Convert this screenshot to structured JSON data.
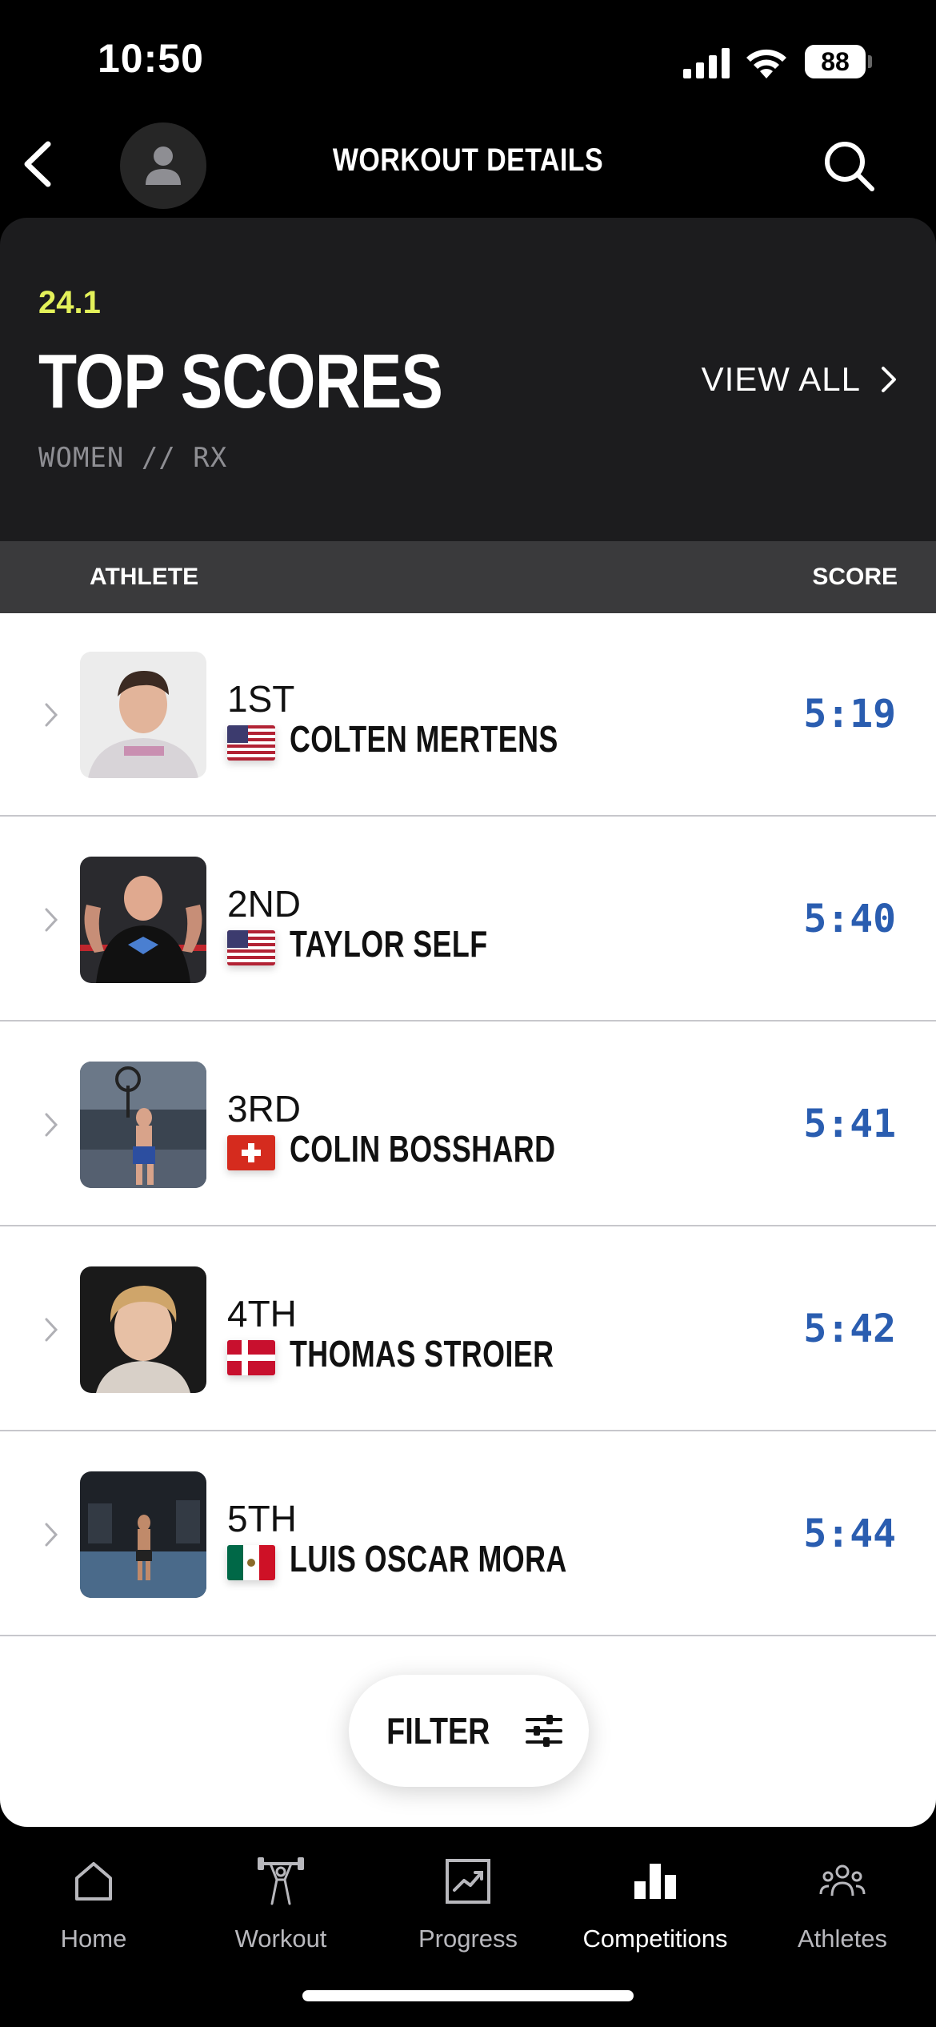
{
  "status_bar": {
    "time": "10:50",
    "battery": "88"
  },
  "nav": {
    "title": "WORKOUT DETAILS"
  },
  "header": {
    "workout_id": "24.1",
    "title": "TOP SCORES",
    "division": "WOMEN // RX",
    "view_all_label": "VIEW ALL"
  },
  "columns": {
    "athlete": "ATHLETE",
    "score": "SCORE"
  },
  "athletes": [
    {
      "rank": "1ST",
      "name": "COLTEN MERTENS",
      "score": "5:19",
      "flag": "us-flag-icon"
    },
    {
      "rank": "2ND",
      "name": "TAYLOR SELF",
      "score": "5:40",
      "flag": "us-flag-icon"
    },
    {
      "rank": "3RD",
      "name": "COLIN BOSSHARD",
      "score": "5:41",
      "flag": "swiss-flag-icon"
    },
    {
      "rank": "4TH",
      "name": "THOMAS STROIER",
      "score": "5:42",
      "flag": "denmark-flag-icon"
    },
    {
      "rank": "5TH",
      "name": "LUIS OSCAR MORA",
      "score": "5:44",
      "flag": "mexico-flag-icon"
    }
  ],
  "filter": {
    "label": "FILTER"
  },
  "tabs": [
    {
      "label": "Home",
      "icon": "home-icon"
    },
    {
      "label": "Workout",
      "icon": "barbell-icon"
    },
    {
      "label": "Progress",
      "icon": "chart-icon"
    },
    {
      "label": "Competitions",
      "icon": "podium-icon"
    },
    {
      "label": "Athletes",
      "icon": "people-icon"
    }
  ],
  "colors": {
    "accent_yellow": "#e3f15a",
    "score_blue": "#2a5db0",
    "card_bg": "#1c1c1e",
    "column_header_bg": "#3a3a3c"
  }
}
